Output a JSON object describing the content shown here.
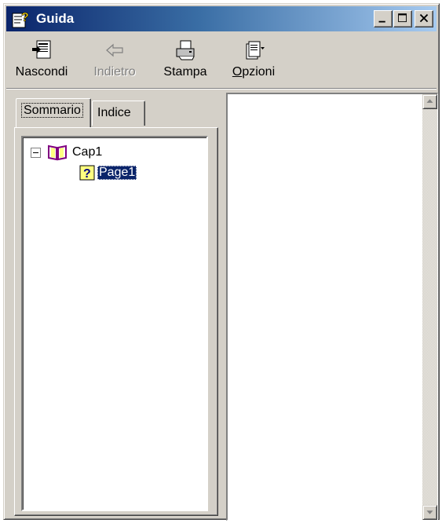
{
  "window": {
    "title": "Guida"
  },
  "toolbar": {
    "hide_label": "Nascondi",
    "back_label": "Indietro",
    "print_label": "Stampa",
    "options_label": "Opzioni"
  },
  "tabs": {
    "contents_label": "Sommario",
    "index_label": "Indice",
    "active": "Sommario"
  },
  "tree": {
    "nodes": [
      {
        "label": "Cap1",
        "icon": "book-open-icon",
        "expanded": true
      },
      {
        "label": "Page1",
        "icon": "help-page-icon",
        "selected": true
      }
    ]
  },
  "colors": {
    "title_bar_start": "#0a246a",
    "title_bar_end": "#a6caf0",
    "selection": "#0a246a",
    "face": "#d4d0c8"
  }
}
